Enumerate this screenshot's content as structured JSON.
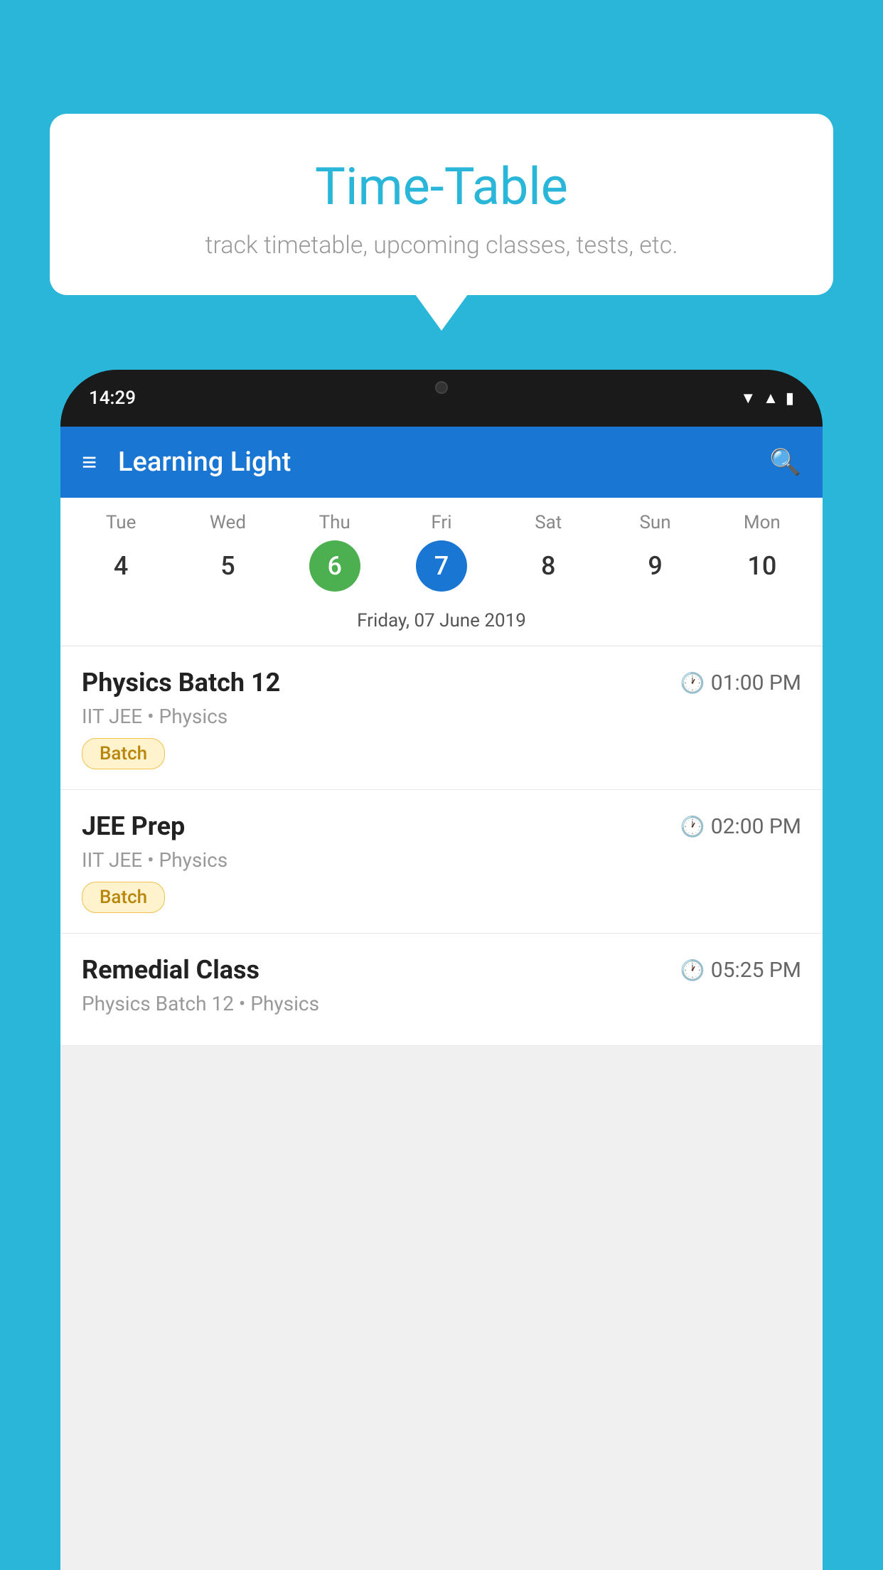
{
  "background_color": "#29B6D8",
  "bubble": {
    "title": "Time-Table",
    "subtitle": "track timetable, upcoming classes, tests, etc."
  },
  "phone": {
    "status_bar": {
      "time": "14:29"
    },
    "app_bar": {
      "title": "Learning Light"
    },
    "calendar": {
      "days": [
        {
          "name": "Tue",
          "number": "4",
          "state": "normal"
        },
        {
          "name": "Wed",
          "number": "5",
          "state": "normal"
        },
        {
          "name": "Thu",
          "number": "6",
          "state": "today"
        },
        {
          "name": "Fri",
          "number": "7",
          "state": "selected"
        },
        {
          "name": "Sat",
          "number": "8",
          "state": "normal"
        },
        {
          "name": "Sun",
          "number": "9",
          "state": "normal"
        },
        {
          "name": "Mon",
          "number": "10",
          "state": "normal"
        }
      ],
      "selected_date_label": "Friday, 07 June 2019"
    },
    "schedule": [
      {
        "name": "Physics Batch 12",
        "time": "01:00 PM",
        "sub": "IIT JEE • Physics",
        "badge": "Batch"
      },
      {
        "name": "JEE Prep",
        "time": "02:00 PM",
        "sub": "IIT JEE • Physics",
        "badge": "Batch"
      },
      {
        "name": "Remedial Class",
        "time": "05:25 PM",
        "sub": "Physics Batch 12 • Physics",
        "badge": null
      }
    ]
  }
}
